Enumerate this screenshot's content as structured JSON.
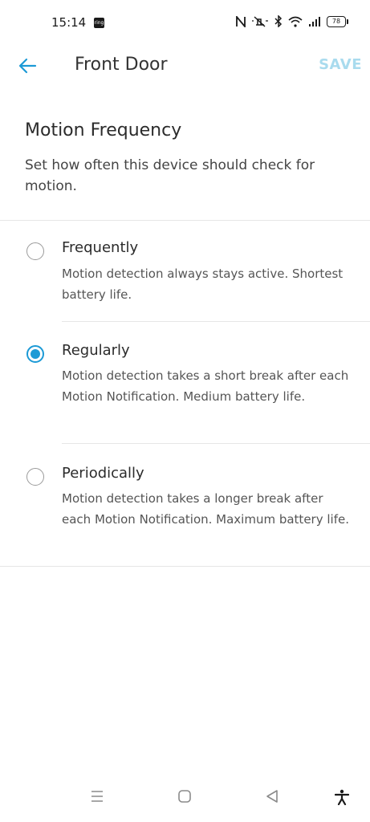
{
  "status_bar": {
    "time": "15:14",
    "app_badge": "ring",
    "battery": "78",
    "icons": [
      "nfc-icon",
      "mute-icon",
      "bluetooth-icon",
      "wifi-icon",
      "signal-icon",
      "battery-icon"
    ]
  },
  "app_bar": {
    "title": "Front Door",
    "save_label": "SAVE",
    "accent_color": "#1c9ad6",
    "save_disabled_color": "#a9dbee"
  },
  "header": {
    "title": "Motion Frequency",
    "description": "Set how often this device should check for motion."
  },
  "options": [
    {
      "title": "Frequently",
      "description": "Motion detection always stays active. Shortest battery life.",
      "selected": false
    },
    {
      "title": "Regularly",
      "description": "Motion detection takes a short break after each Motion Notification. Medium battery life.",
      "selected": true
    },
    {
      "title": "Periodically",
      "description": "Motion detection takes a longer break after each Motion Notification. Maximum battery life.",
      "selected": false
    }
  ],
  "nav_bar": {
    "icons": [
      "menu-icon",
      "home-icon",
      "back-triangle-icon",
      "accessibility-icon"
    ]
  }
}
